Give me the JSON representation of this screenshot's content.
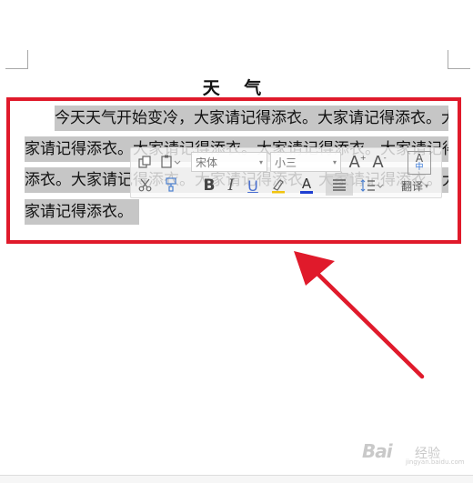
{
  "document": {
    "title": "天 气",
    "lines": [
      "今天天气开始变冷，大家请记得添衣。大家请记得添衣。大",
      "家请记得添衣。大家请记得添衣。大家请记得添衣。大家请记得",
      "添衣。大家请记得添衣。大家请记得添衣。大家请记得添衣。大",
      "家请记得添衣。"
    ]
  },
  "toolbar": {
    "font_name": "宋体",
    "font_size": "小三",
    "font_name_dropdown_arrow": "▾",
    "font_size_dropdown_arrow": "▾",
    "grow_font": "A",
    "shrink_font": "A",
    "bold": "B",
    "italic": "I",
    "underline": "U",
    "font_color": "A",
    "translate": "翻译",
    "pinyin_top": "A",
    "pinyin_bottom": "中"
  },
  "watermark": {
    "brand": "Bai",
    "sub": "经验",
    "url": "jingyan.baidu.com"
  },
  "colors": {
    "selection": "#c6c6c6",
    "annotation_red": "#e01a2b"
  }
}
